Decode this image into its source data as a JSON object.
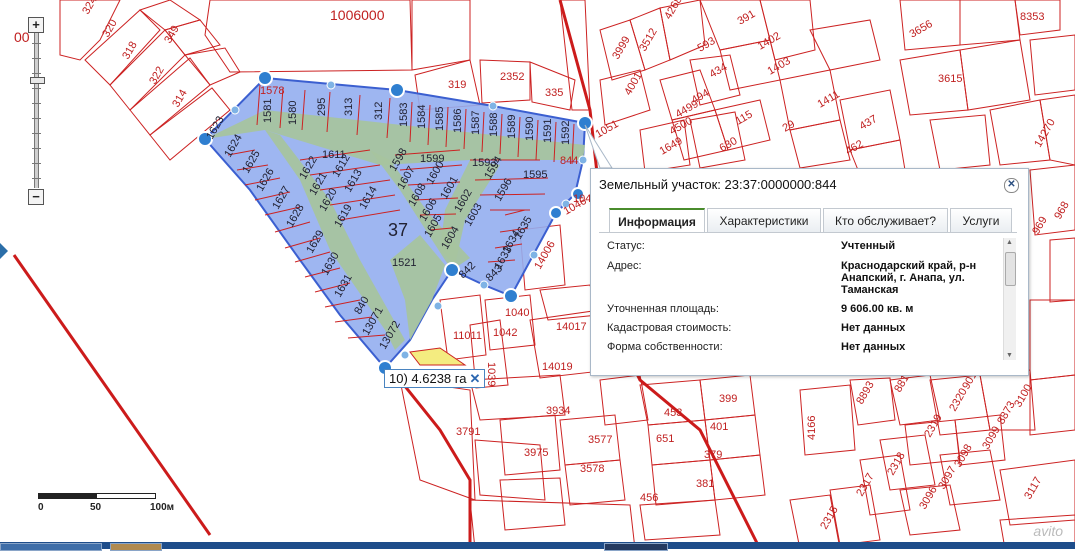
{
  "map": {
    "top_parcel_label": "1006000",
    "left_edge_label": "00",
    "block_label": "37",
    "center_parcel": "1521",
    "parcels": [
      {
        "n": "324"
      },
      {
        "n": "320"
      },
      {
        "n": "318"
      },
      {
        "n": "349"
      },
      {
        "n": "322"
      },
      {
        "n": "314"
      },
      {
        "n": "319"
      },
      {
        "n": "2352"
      },
      {
        "n": "335"
      },
      {
        "n": "3999"
      },
      {
        "n": "3512"
      },
      {
        "n": "4268"
      },
      {
        "n": "4001"
      },
      {
        "n": "391"
      },
      {
        "n": "593"
      },
      {
        "n": "1402"
      },
      {
        "n": "434"
      },
      {
        "n": "1403"
      },
      {
        "n": "494"
      },
      {
        "n": "4499"
      },
      {
        "n": "4500"
      },
      {
        "n": "115"
      },
      {
        "n": "1649"
      },
      {
        "n": "630"
      },
      {
        "n": "1411"
      },
      {
        "n": "29"
      },
      {
        "n": "437"
      },
      {
        "n": "462"
      },
      {
        "n": "3615"
      },
      {
        "n": "1051"
      },
      {
        "n": "844"
      },
      {
        "n": "1046"
      },
      {
        "n": "1047"
      },
      {
        "n": "14270"
      },
      {
        "n": "968"
      },
      {
        "n": "969"
      },
      {
        "n": "1040"
      },
      {
        "n": "14006"
      },
      {
        "n": "1042"
      },
      {
        "n": "14017"
      },
      {
        "n": "1039"
      },
      {
        "n": "14019"
      },
      {
        "n": "11011"
      },
      {
        "n": "3934"
      },
      {
        "n": "3791"
      },
      {
        "n": "3975"
      },
      {
        "n": "3577"
      },
      {
        "n": "3578"
      },
      {
        "n": "453"
      },
      {
        "n": "399"
      },
      {
        "n": "651"
      },
      {
        "n": "401"
      },
      {
        "n": "379"
      },
      {
        "n": "381"
      },
      {
        "n": "456"
      },
      {
        "n": "4166"
      },
      {
        "n": "8893"
      },
      {
        "n": "8814"
      },
      {
        "n": "9012"
      },
      {
        "n": "3100"
      },
      {
        "n": "8873"
      },
      {
        "n": "2320"
      },
      {
        "n": "2319"
      },
      {
        "n": "3099"
      },
      {
        "n": "3098"
      },
      {
        "n": "3097"
      },
      {
        "n": "3096"
      },
      {
        "n": "2318"
      },
      {
        "n": "2317"
      },
      {
        "n": "2315"
      },
      {
        "n": "3117"
      },
      {
        "n": "3656"
      },
      {
        "n": "8353"
      },
      {
        "n": "1578"
      },
      {
        "n": "1581"
      },
      {
        "n": "1580"
      },
      {
        "n": "295"
      },
      {
        "n": "313"
      },
      {
        "n": "312"
      },
      {
        "n": "1583"
      },
      {
        "n": "1584"
      },
      {
        "n": "1585"
      },
      {
        "n": "1586"
      },
      {
        "n": "1587"
      },
      {
        "n": "1588"
      },
      {
        "n": "1589"
      },
      {
        "n": "1590"
      },
      {
        "n": "1591"
      },
      {
        "n": "1592"
      },
      {
        "n": "1623"
      },
      {
        "n": "1624"
      },
      {
        "n": "1625"
      },
      {
        "n": "1626"
      },
      {
        "n": "1627"
      },
      {
        "n": "1628"
      },
      {
        "n": "1629"
      },
      {
        "n": "1630"
      },
      {
        "n": "1631"
      },
      {
        "n": "840"
      },
      {
        "n": "13071"
      },
      {
        "n": "13072"
      },
      {
        "n": "1611"
      },
      {
        "n": "1622"
      },
      {
        "n": "1621"
      },
      {
        "n": "1612"
      },
      {
        "n": "1620"
      },
      {
        "n": "1613"
      },
      {
        "n": "1619"
      },
      {
        "n": "1614"
      },
      {
        "n": "1598"
      },
      {
        "n": "1599"
      },
      {
        "n": "1607"
      },
      {
        "n": "1600"
      },
      {
        "n": "1608"
      },
      {
        "n": "1601"
      },
      {
        "n": "1606"
      },
      {
        "n": "1602"
      },
      {
        "n": "1605"
      },
      {
        "n": "1603"
      },
      {
        "n": "1604"
      },
      {
        "n": "1593"
      },
      {
        "n": "1594"
      },
      {
        "n": "1595"
      },
      {
        "n": "1596"
      },
      {
        "n": "1635"
      },
      {
        "n": "1634"
      },
      {
        "n": "1633"
      },
      {
        "n": "843"
      },
      {
        "n": "842"
      }
    ]
  },
  "measurement": {
    "label": "10) 4.6238 га",
    "close": "✕"
  },
  "zoom": {
    "plus": "+",
    "minus": "−"
  },
  "scale": {
    "labels": [
      "0",
      "50",
      "100м"
    ]
  },
  "popup": {
    "title": "Земельный участок: 23:37:0000000:844",
    "close": "✕",
    "tabs": [
      "Информация",
      "Характеристики",
      "Кто обслуживает?",
      "Услуги"
    ],
    "active_tab": "Информация",
    "rows": [
      {
        "label": "Статус:",
        "value": "Учтенный"
      },
      {
        "label": "Адрес:",
        "value": "Краснодарский край, р-н Анапский, г. Анапа, ул. Таманская"
      },
      {
        "label": "Уточненная площадь:",
        "value": "9 606.00 кв. м"
      },
      {
        "label": "Кадастровая стоимость:",
        "value": "Нет данных"
      },
      {
        "label": "Форма собственности:",
        "value": "Нет данных"
      }
    ]
  },
  "watermark": "avito",
  "colors": {
    "parcel_line": "#cc2222",
    "selection_fill": "#93aef0",
    "road_fill": "#a7c49f",
    "highlight": "#f4ec80",
    "accent": "#4a8c2c"
  }
}
